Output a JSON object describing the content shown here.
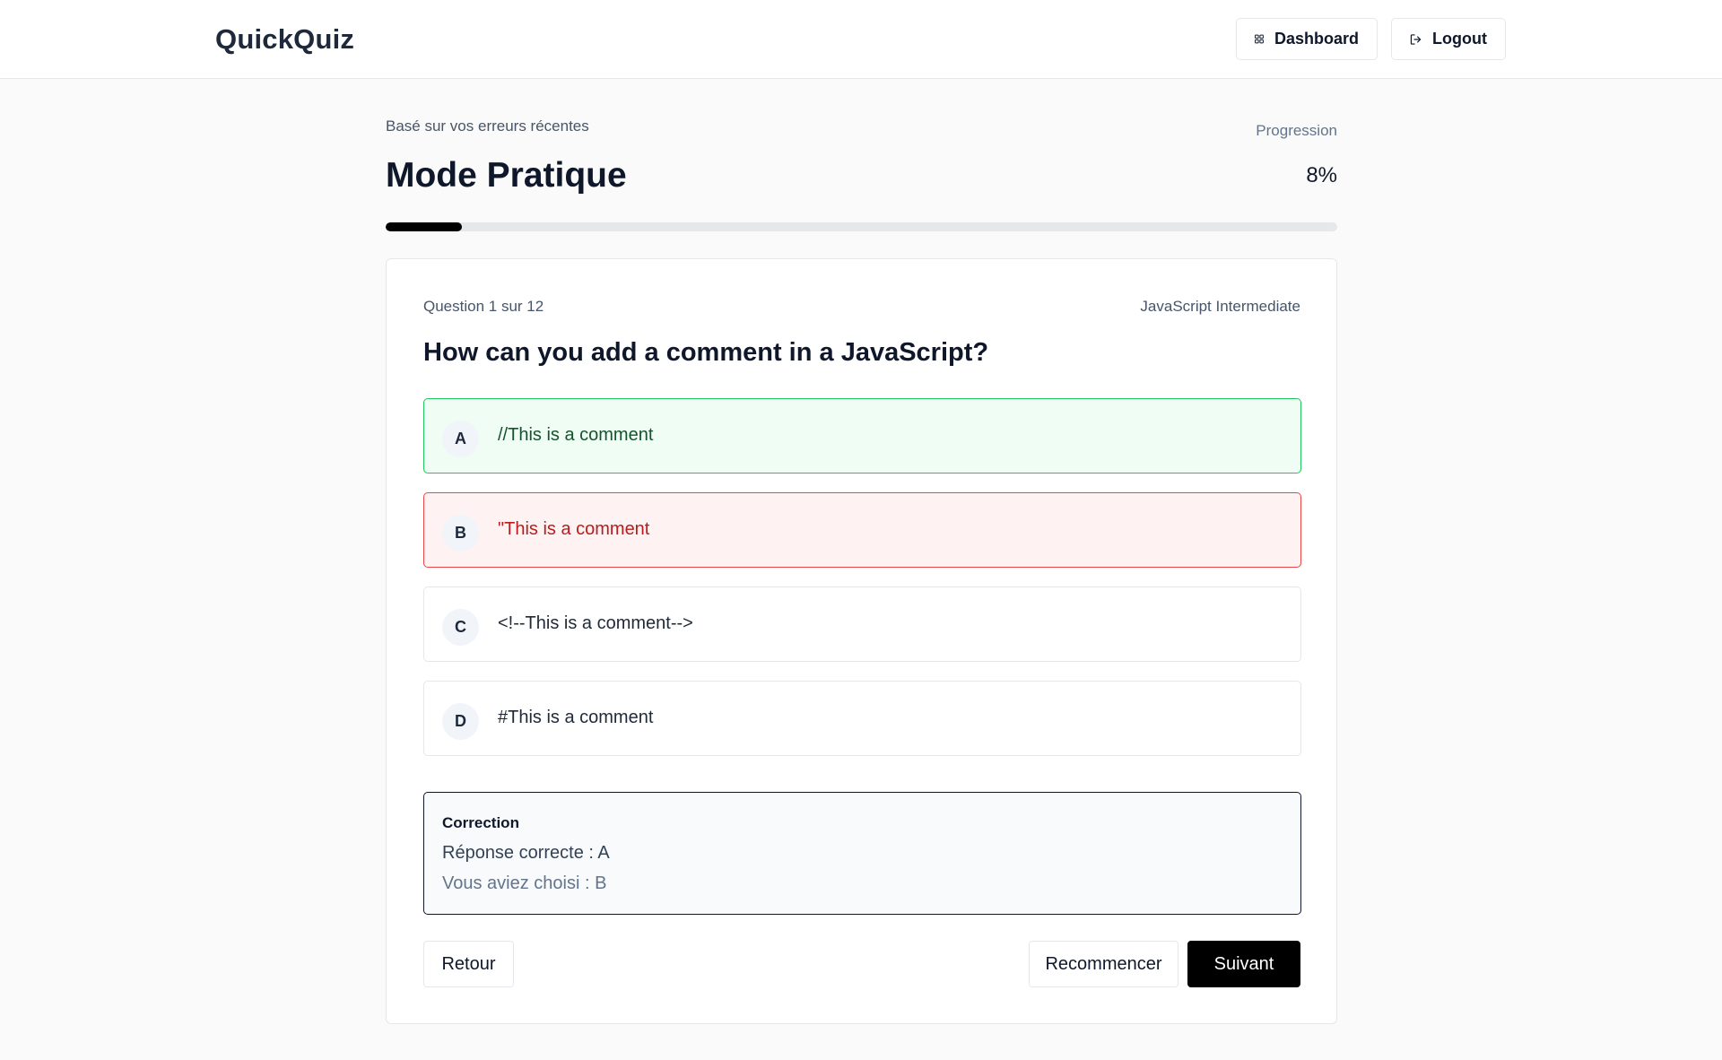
{
  "header": {
    "brand": "QuickQuiz",
    "dashboard_label": "Dashboard",
    "logout_label": "Logout"
  },
  "practice": {
    "subtitle": "Basé sur vos erreurs récentes",
    "title": "Mode Pratique",
    "progress_label": "Progression",
    "progress_value_text": "8%",
    "progress_fraction": 0.08
  },
  "question": {
    "counter": "Question 1 sur 12",
    "topic": "JavaScript Intermediate",
    "text": "How can you add a comment in a JavaScript?",
    "options": [
      {
        "letter": "A",
        "text": "//This is a comment",
        "state": "correct"
      },
      {
        "letter": "B",
        "text": "\"This is a comment",
        "state": "wrong"
      },
      {
        "letter": "C",
        "text": "<!--This is a comment-->",
        "state": "neutral"
      },
      {
        "letter": "D",
        "text": "#This is a comment",
        "state": "neutral"
      }
    ]
  },
  "correction": {
    "title": "Correction",
    "correct_answer": "Réponse correcte : A",
    "chosen_answer": "Vous aviez choisi : B"
  },
  "actions": {
    "back_label": "Retour",
    "restart_label": "Recommencer",
    "next_label": "Suivant"
  },
  "colors": {
    "correct_border": "#22c55e",
    "correct_bg": "#effdf4",
    "wrong_border": "#ef4444",
    "wrong_bg": "#fef2f2",
    "primary": "#000000"
  },
  "icons": {
    "dashboard": "grid-icon",
    "logout": "logout-icon"
  }
}
